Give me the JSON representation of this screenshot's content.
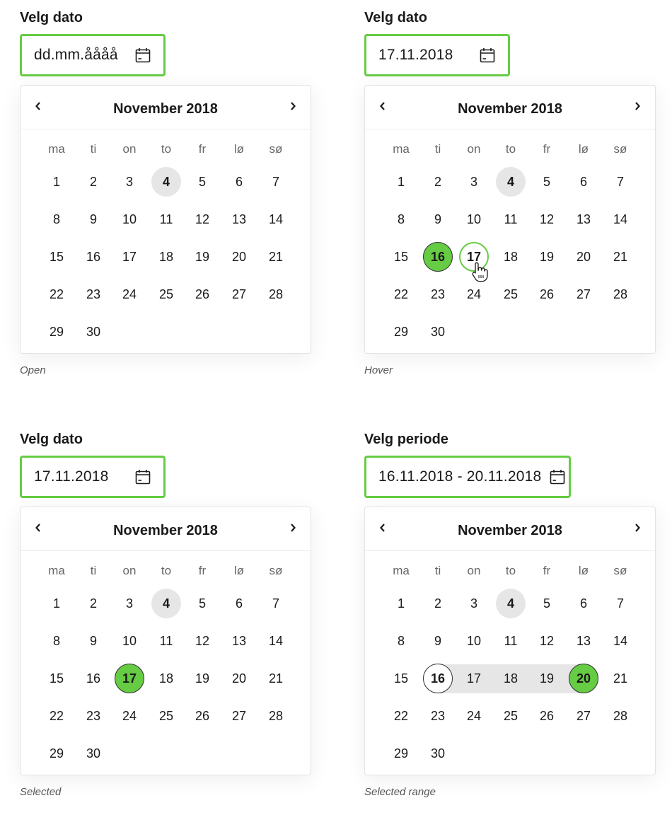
{
  "weekdays": [
    "ma",
    "ti",
    "on",
    "to",
    "fr",
    "lø",
    "sø"
  ],
  "colors": {
    "accent": "#66cc44",
    "today_bg": "#e6e6e6",
    "range_bg": "#e6e6e6"
  },
  "icons": {
    "calendar": "calendar-icon",
    "prev": "chevron-left-icon",
    "next": "chevron-right-icon",
    "cursor": "pointer-hand-icon"
  },
  "variants": {
    "open": {
      "label": "Velg dato",
      "input_value": "dd.mm.åååå",
      "month": "November 2018",
      "caption": "Open",
      "today": 4
    },
    "hover": {
      "label": "Velg dato",
      "input_value": "17.11.2018",
      "month": "November 2018",
      "caption": "Hover",
      "today": 4,
      "selected": 16,
      "hovered": 17
    },
    "selected": {
      "label": "Velg dato",
      "input_value": "17.11.2018",
      "month": "November 2018",
      "caption": "Selected",
      "today": 4,
      "selected": 17
    },
    "range": {
      "label": "Velg periode",
      "input_value": "16.11.2018 - 20.11.2018",
      "month": "November 2018",
      "caption": "Selected range",
      "today": 4,
      "range_start": 16,
      "range_end": 20
    }
  }
}
